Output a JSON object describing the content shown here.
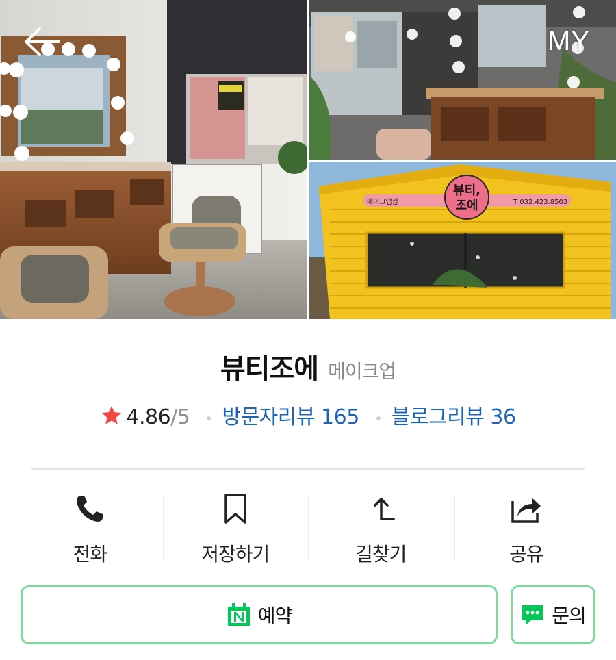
{
  "header": {
    "right_label": "MY"
  },
  "place": {
    "name": "뷰티조에",
    "category": "메이크업"
  },
  "rating": {
    "score": "4.86",
    "max": "/5"
  },
  "reviews": {
    "visitor": "방문자리뷰 165",
    "blog": "블로그리뷰 36"
  },
  "actions": [
    {
      "label": "전화",
      "icon": "phone-icon"
    },
    {
      "label": "저장하기",
      "icon": "bookmark-icon"
    },
    {
      "label": "길찾기",
      "icon": "directions-icon"
    },
    {
      "label": "공유",
      "icon": "share-icon"
    }
  ],
  "buttons": {
    "reserve": "예약",
    "inquire": "문의"
  },
  "sign": {
    "left_text": "메이크업샵",
    "logo_line1": "뷰티,",
    "logo_line2": "조에",
    "phone": "T 032.423.8503"
  },
  "colors": {
    "accent_green": "#03c75a",
    "link_blue": "#1a63b7",
    "star_red": "#f04848",
    "border_green": "#7fd99b"
  }
}
